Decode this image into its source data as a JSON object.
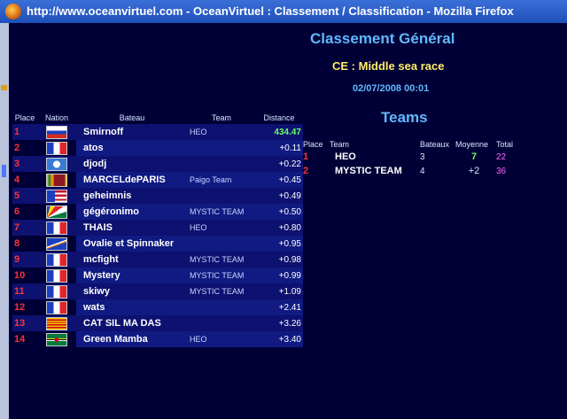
{
  "window": {
    "title": "http://www.oceanvirtuel.com - OceanVirtuel : Classement / Classification - Mozilla Firefox"
  },
  "header": {
    "title": "Classement Général",
    "race": "CE : Middle sea race",
    "datetime": "02/07/2008 00:01"
  },
  "ranking": {
    "headers": {
      "place": "Place",
      "nation": "Nation",
      "boat": "Bateau",
      "team": "Team",
      "distance": "Distance"
    },
    "rows": [
      {
        "place": "1",
        "flag": "flag-russia",
        "boat": "Smirnoff",
        "team": "HEO",
        "distance": "434.47"
      },
      {
        "place": "2",
        "flag": "flag-france",
        "boat": "atos",
        "team": "",
        "distance": "+0.11"
      },
      {
        "place": "3",
        "flag": "flag-antarctica",
        "boat": "djodj",
        "team": "",
        "distance": "+0.22"
      },
      {
        "place": "4",
        "flag": "flag-sri-lanka",
        "boat": "MARCELdePARIS",
        "team": "Paigo Team",
        "distance": "+0.45"
      },
      {
        "place": "5",
        "flag": "flag-liberia",
        "boat": "geheimnis",
        "team": "",
        "distance": "+0.49"
      },
      {
        "place": "6",
        "flag": "flag-seychelles",
        "boat": "gégéronimo",
        "team": "MYSTIC TEAM",
        "distance": "+0.50"
      },
      {
        "place": "7",
        "flag": "flag-france",
        "boat": "THAIS",
        "team": "HEO",
        "distance": "+0.80"
      },
      {
        "place": "8",
        "flag": "flag-marshall-islands",
        "boat": "Ovalie et Spinnaker",
        "team": "",
        "distance": "+0.95"
      },
      {
        "place": "9",
        "flag": "flag-france",
        "boat": "mcfight",
        "team": "MYSTIC TEAM",
        "distance": "+0.98"
      },
      {
        "place": "10",
        "flag": "flag-france",
        "boat": "Mystery",
        "team": "MYSTIC TEAM",
        "distance": "+0.99"
      },
      {
        "place": "11",
        "flag": "flag-france",
        "boat": "skiwy",
        "team": "MYSTIC TEAM",
        "distance": "+1.09"
      },
      {
        "place": "12",
        "flag": "flag-france",
        "boat": "wats",
        "team": "",
        "distance": "+2.41"
      },
      {
        "place": "13",
        "flag": "flag-catalonia",
        "boat": "CAT SIL MA DAS",
        "team": "",
        "distance": "+3.26"
      },
      {
        "place": "14",
        "flag": "flag-dominica",
        "boat": "Green Mamba",
        "team": "HEO",
        "distance": "+3.40"
      }
    ]
  },
  "teams": {
    "title": "Teams",
    "headers": {
      "place": "Place",
      "team": "Team",
      "boats": "Bateaux",
      "average": "Moyenne",
      "total": "Total"
    },
    "rows": [
      {
        "place": "1",
        "team": "HEO",
        "boats": "3",
        "average": "7",
        "total": "22"
      },
      {
        "place": "2",
        "team": "MYSTIC TEAM",
        "boats": "4",
        "average": "+2",
        "total": "36"
      }
    ]
  },
  "colors": {
    "background": "#000036",
    "heading": "#62b8ff",
    "race": "#ffee66",
    "place": "#ff3333",
    "lead": "#66ff66",
    "total": "#ff66ff"
  }
}
